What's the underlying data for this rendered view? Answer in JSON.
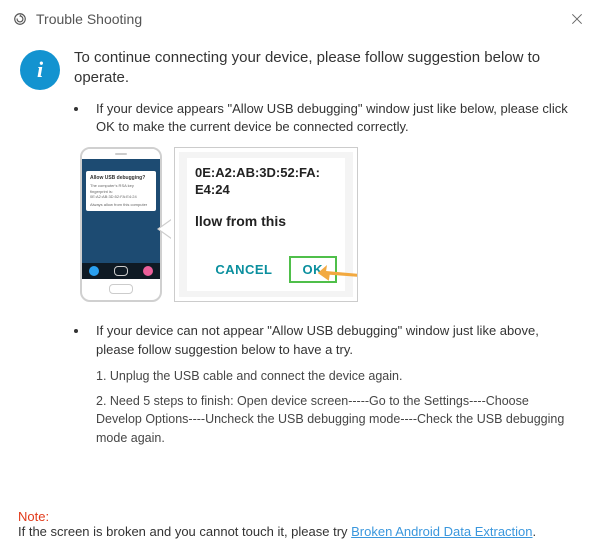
{
  "titlebar": {
    "title": "Trouble Shooting"
  },
  "info_glyph": "i",
  "lead": "To continue connecting your device, please follow suggestion below to operate.",
  "bullet1": "If your device appears \"Allow USB debugging\" window just like below, please click OK to make the current device  be connected correctly.",
  "phone_dialog": {
    "title": "Allow USB debugging?",
    "line1": "The computer's RSA key fingerprint is:",
    "line2": "0E:A2:AB:3D:52:FA:E4:24",
    "check": "Always allow from this computer"
  },
  "crop": {
    "fingerprint_l1": "0E:A2:AB:3D:52:FA:",
    "fingerprint_l2": "E4:24",
    "allow": "llow from this",
    "cancel": "CANCEL",
    "ok": "OK"
  },
  "bullet2": "If your device can not appear \"Allow USB debugging\" window just like above, please follow suggestion below to have a try.",
  "steps": {
    "s1": "1. Unplug the USB cable and connect the device again.",
    "s2": "2. Need 5 steps to finish: Open device screen-----Go to the Settings----Choose Develop Options----Uncheck the USB debugging mode----Check the USB debugging mode again."
  },
  "note": {
    "label": "Note:",
    "text": "If the screen is broken and you cannot touch it, please try ",
    "link": "Broken Android Data Extraction",
    "tail": "."
  }
}
